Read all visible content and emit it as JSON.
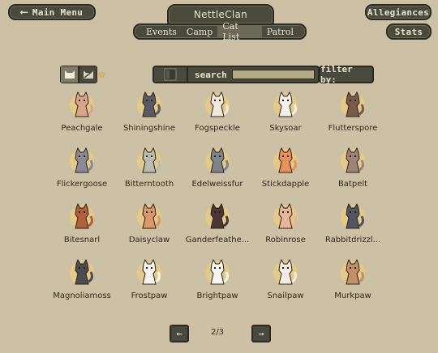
{
  "nav": {
    "main_menu": "Main Menu",
    "clan_name": "NettleClan",
    "allegiances": "Allegiances",
    "stats": "Stats",
    "tabs": [
      {
        "label": "Events"
      },
      {
        "label": "Camp"
      },
      {
        "label": "Cat List",
        "active": true
      },
      {
        "label": "Patrol"
      }
    ]
  },
  "filters": {
    "search_label": "search",
    "search_value": "",
    "filter_label": "filter by:"
  },
  "cats": [
    {
      "name": "Peachgale",
      "fur": "#d9a58a"
    },
    {
      "name": "Shiningshine",
      "fur": "#5a5a66"
    },
    {
      "name": "Fogspeckle",
      "fur": "#efe8dc"
    },
    {
      "name": "Skysoar",
      "fur": "#f3f0ea"
    },
    {
      "name": "Flutterspore",
      "fur": "#7a5a4a"
    },
    {
      "name": "Flickergoose",
      "fur": "#8a8a96"
    },
    {
      "name": "Bitterntooth",
      "fur": "#b8bcb4"
    },
    {
      "name": "Edelweissfur",
      "fur": "#7e848c"
    },
    {
      "name": "Stickdapple",
      "fur": "#e8905a"
    },
    {
      "name": "Batpelt",
      "fur": "#9c8478"
    },
    {
      "name": "Bitesnarl",
      "fur": "#b0603a"
    },
    {
      "name": "Daisyclaw",
      "fur": "#d8986a"
    },
    {
      "name": "Ganderfeathe...",
      "fur": "#4a3634"
    },
    {
      "name": "Robinrose",
      "fur": "#e8b49a"
    },
    {
      "name": "Rabbitdrizzl...",
      "fur": "#505660"
    },
    {
      "name": "Magnoliamoss",
      "fur": "#4a4e52"
    },
    {
      "name": "Frostpaw",
      "fur": "#f6f4f0"
    },
    {
      "name": "Brightpaw",
      "fur": "#f6f4f0"
    },
    {
      "name": "Snailpaw",
      "fur": "#f3ece4"
    },
    {
      "name": "Murkpaw",
      "fur": "#c09066"
    }
  ],
  "pager": {
    "prev": "←",
    "next": "→",
    "indicator": "2/3"
  },
  "colors": {
    "background": "#cdc1a5",
    "button": "#4a4a3c",
    "portrait_bg": "#e3ca86",
    "star": "#e6c244"
  }
}
